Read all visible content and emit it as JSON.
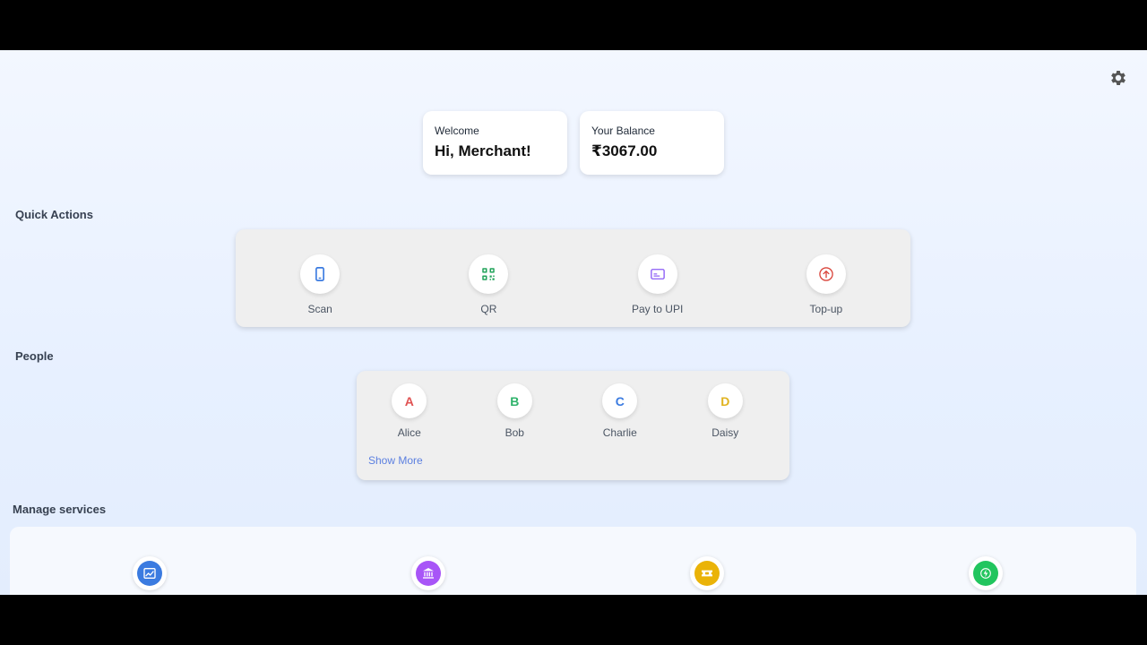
{
  "header": {
    "welcome_label": "Welcome",
    "greeting": "Hi, Merchant!",
    "balance_label": "Your Balance",
    "balance_value": "₹3067.00"
  },
  "sections": {
    "quick_actions": "Quick Actions",
    "people": "People",
    "manage_services": "Manage services"
  },
  "quick_actions": [
    {
      "label": "Scan",
      "icon": "phone-icon",
      "color": "#3b7be0"
    },
    {
      "label": "QR",
      "icon": "qr-code-icon",
      "color": "#22a35a"
    },
    {
      "label": "Pay to UPI",
      "icon": "card-icon",
      "color": "#8b5cf6"
    },
    {
      "label": "Top-up",
      "icon": "arrow-up-circle-icon",
      "color": "#d9443a"
    }
  ],
  "people": [
    {
      "initial": "A",
      "name": "Alice",
      "color": "#e05252"
    },
    {
      "initial": "B",
      "name": "Bob",
      "color": "#2fb36b"
    },
    {
      "initial": "C",
      "name": "Charlie",
      "color": "#3b7be0"
    },
    {
      "initial": "D",
      "name": "Daisy",
      "color": "#e0b320"
    }
  ],
  "show_more": "Show More",
  "services": [
    {
      "icon": "chart-icon",
      "color": "#3b7be0"
    },
    {
      "icon": "bank-icon",
      "color": "#a855f7"
    },
    {
      "icon": "ticket-icon",
      "color": "#eab308"
    },
    {
      "icon": "lightning-icon",
      "color": "#22c55e"
    }
  ]
}
